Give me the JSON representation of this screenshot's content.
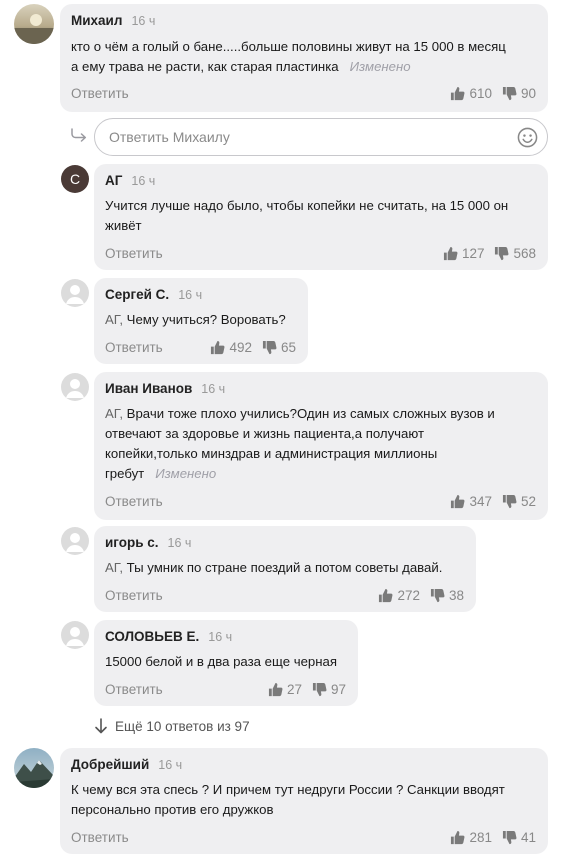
{
  "comments": [
    {
      "author": "Михаил",
      "time": "16 ч",
      "lines": [
        "кто о чём а голый о бане.....больше половины живут на 15 000 в месяц",
        "а ему трава не расти, как старая пластинка"
      ],
      "edited": "Изменено",
      "reply": "Ответить",
      "likes": "610",
      "dislikes": "90",
      "avatar": "sunset-photo"
    },
    {
      "author": "АГ",
      "time": "16 ч",
      "avatar_letter": "С",
      "lines": [
        "Учится лучше надо было, чтобы копейки не считать, на 15 000 он",
        "живёт"
      ],
      "reply": "Ответить",
      "likes": "127",
      "dislikes": "568"
    },
    {
      "author": "Сергей С.",
      "time": "16 ч",
      "mention": "АГ,",
      "lines": [
        "Чему учиться? Воровать?"
      ],
      "reply": "Ответить",
      "likes": "492",
      "dislikes": "65"
    },
    {
      "author": "Иван Иванов",
      "time": "16 ч",
      "mention": "АГ,",
      "lines": [
        "Врачи тоже плохо учились?Один из самых сложных вузов и",
        "отвечают за здоровье и жизнь пациента,а получают",
        "копейки,только минздрав и администрация миллионы",
        "гребут"
      ],
      "edited": "Изменено",
      "reply": "Ответить",
      "likes": "347",
      "dislikes": "52"
    },
    {
      "author": "игорь с.",
      "time": "16 ч",
      "mention": "АГ,",
      "lines": [
        "Ты умник по стране поездий а потом советы давай."
      ],
      "reply": "Ответить",
      "likes": "272",
      "dislikes": "38"
    },
    {
      "author": "СОЛОВЬЕВ Е.",
      "time": "16 ч",
      "lines": [
        "15000 белой и в два раза еще черная"
      ],
      "reply": "Ответить",
      "likes": "27",
      "dislikes": "97"
    },
    {
      "author": "Добрейший",
      "time": "16 ч",
      "lines": [
        "К чему вся эта спесь ? И причем тут недруги России ? Санкции вводят",
        "персонально против его дружков"
      ],
      "reply": "Ответить",
      "likes": "281",
      "dislikes": "41",
      "avatar": "mountain-photo"
    }
  ],
  "reply_box": {
    "placeholder": "Ответить Михаилу"
  },
  "more_replies": "Ещё 10 ответов из 97",
  "icons": [
    "thumbs-up-icon",
    "thumbs-down-icon",
    "reply-arrow-icon",
    "emoji-icon",
    "arrow-down-icon",
    "user-placeholder-icon"
  ]
}
